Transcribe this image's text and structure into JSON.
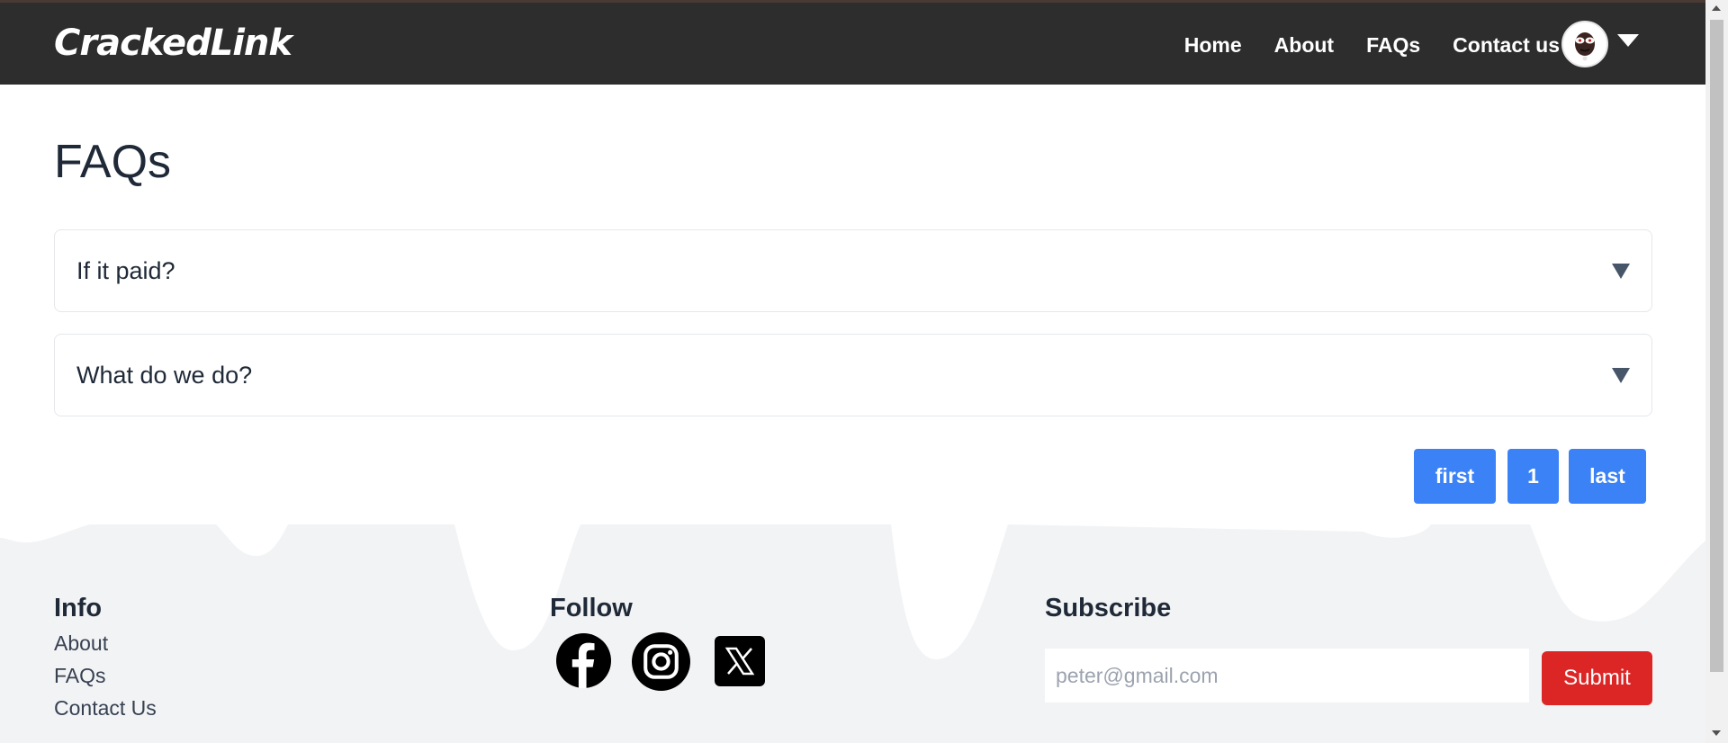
{
  "header": {
    "brand": "CrackedLink",
    "nav": [
      "Home",
      "About",
      "FAQs",
      "Contact us"
    ]
  },
  "main": {
    "title": "FAQs",
    "faqs": [
      {
        "question": "If it paid?"
      },
      {
        "question": "What do we do?"
      }
    ],
    "pagination": {
      "first": "first",
      "page": "1",
      "last": "last"
    }
  },
  "footer": {
    "info": {
      "title": "Info",
      "links": [
        "About",
        "FAQs",
        "Contact Us"
      ]
    },
    "follow": {
      "title": "Follow",
      "icons": [
        "facebook-icon",
        "instagram-icon",
        "x-twitter-icon"
      ]
    },
    "subscribe": {
      "title": "Subscribe",
      "placeholder": "peter@gmail.com",
      "button": "Submit"
    }
  },
  "colors": {
    "navbar": "#2d2d2d",
    "pagination": "#3b82f6",
    "submit": "#dc2626",
    "footer": "#f2f3f5"
  }
}
